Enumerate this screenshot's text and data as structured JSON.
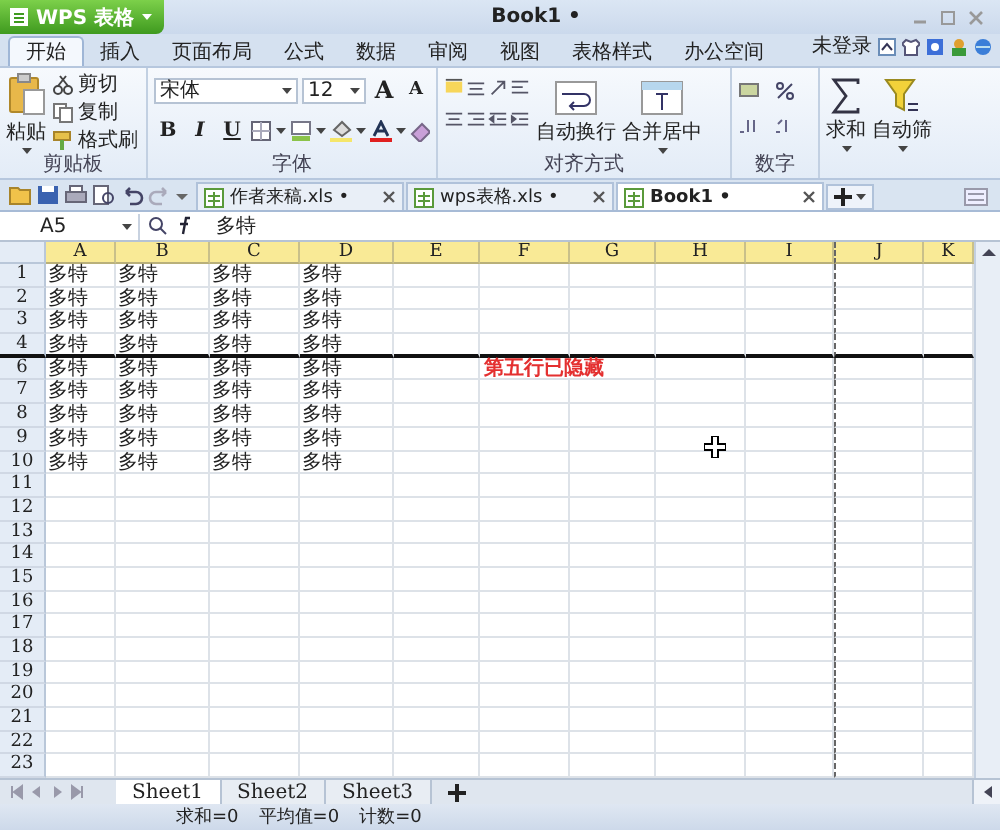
{
  "app_button": {
    "label": "WPS 表格"
  },
  "window": {
    "title": "Book1 •"
  },
  "menu_tabs": [
    {
      "label": "开始",
      "selected": true
    },
    {
      "label": "插入",
      "selected": false
    },
    {
      "label": "页面布局",
      "selected": false
    },
    {
      "label": "公式",
      "selected": false
    },
    {
      "label": "数据",
      "selected": false
    },
    {
      "label": "审阅",
      "selected": false
    },
    {
      "label": "视图",
      "selected": false
    },
    {
      "label": "表格样式",
      "selected": false
    },
    {
      "label": "办公空间",
      "selected": false
    }
  ],
  "account": {
    "label": "未登录"
  },
  "ribbon": {
    "clipboard": {
      "title": "剪贴板",
      "paste": "粘贴",
      "items": [
        "剪切",
        "复制",
        "格式刷"
      ]
    },
    "font": {
      "title": "字体",
      "name": "宋体",
      "size": "12",
      "grow": "A",
      "shrink": "A",
      "styles": [
        "B",
        "I",
        "U"
      ]
    },
    "alignment": {
      "title": "对齐方式",
      "wrap": "自动换行",
      "merge": "合并居中"
    },
    "number": {
      "title": "数字"
    },
    "sum": {
      "label": "求和"
    },
    "filter": {
      "label": "自动筛"
    }
  },
  "doc_tabs": [
    {
      "label": "作者来稿.xls •",
      "selected": false
    },
    {
      "label": "wps表格.xls •",
      "selected": false
    },
    {
      "label": "Book1 •",
      "selected": true
    }
  ],
  "formula_bar": {
    "cell": "A5",
    "value": "多特"
  },
  "sheet": {
    "columns": [
      "A",
      "B",
      "C",
      "D",
      "E",
      "F",
      "G",
      "H",
      "I",
      "J",
      "K"
    ],
    "rows": [
      {
        "header": "1",
        "cells": [
          "多特",
          "多特",
          "多特",
          "多特"
        ],
        "hidden_below": false
      },
      {
        "header": "2",
        "cells": [
          "多特",
          "多特",
          "多特",
          "多特"
        ],
        "hidden_below": false
      },
      {
        "header": "3",
        "cells": [
          "多特",
          "多特",
          "多特",
          "多特"
        ],
        "hidden_below": false
      },
      {
        "header": "4",
        "cells": [
          "多特",
          "多特",
          "多特",
          "多特"
        ],
        "hidden_below": true
      },
      {
        "header": "6",
        "cells": [
          "多特",
          "多特",
          "多特",
          "多特"
        ],
        "hidden_below": false,
        "note": "第五行已隐藏"
      },
      {
        "header": "7",
        "cells": [
          "多特",
          "多特",
          "多特",
          "多特"
        ],
        "hidden_below": false
      },
      {
        "header": "8",
        "cells": [
          "多特",
          "多特",
          "多特",
          "多特"
        ],
        "hidden_below": false
      },
      {
        "header": "9",
        "cells": [
          "多特",
          "多特",
          "多特",
          "多特"
        ],
        "hidden_below": false
      },
      {
        "header": "10",
        "cells": [
          "多特",
          "多特",
          "多特",
          "多特"
        ],
        "hidden_below": false
      },
      {
        "header": "11",
        "hidden_below": false
      },
      {
        "header": "12",
        "hidden_below": false
      },
      {
        "header": "13",
        "hidden_below": false
      },
      {
        "header": "14",
        "hidden_below": false
      },
      {
        "header": "15",
        "hidden_below": false
      },
      {
        "header": "16",
        "hidden_below": false
      },
      {
        "header": "17",
        "hidden_below": false
      },
      {
        "header": "18",
        "hidden_below": false
      },
      {
        "header": "19",
        "hidden_below": false
      },
      {
        "header": "20",
        "hidden_below": false
      },
      {
        "header": "21",
        "hidden_below": false
      },
      {
        "header": "22",
        "hidden_below": false
      },
      {
        "header": "23",
        "hidden_below": false
      }
    ]
  },
  "sheet_tabs": [
    {
      "label": "Sheet1",
      "selected": true
    },
    {
      "label": "Sheet2",
      "selected": false
    },
    {
      "label": "Sheet3",
      "selected": false
    }
  ],
  "status_bar": {
    "items": [
      "求和=0",
      "平均值=0",
      "计数=0"
    ]
  }
}
